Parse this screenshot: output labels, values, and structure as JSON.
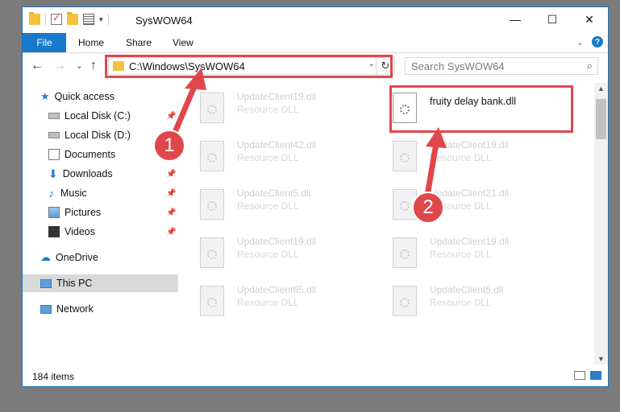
{
  "window": {
    "title": "SysWOW64"
  },
  "ribbon": {
    "tabs": [
      "File",
      "Home",
      "Share",
      "View"
    ]
  },
  "address": {
    "path": "C:\\Windows\\SysWOW64"
  },
  "search": {
    "placeholder": "Search SysWOW64"
  },
  "nav": {
    "quick_access": "Quick access",
    "items": [
      "Local Disk (C:)",
      "Local Disk (D:)",
      "Documents",
      "Downloads",
      "Music",
      "Pictures",
      "Videos"
    ],
    "onedrive": "OneDrive",
    "this_pc": "This PC",
    "network": "Network"
  },
  "files": {
    "left": [
      {
        "name": "UpdateClient19.dll",
        "type": "Resource DLL"
      },
      {
        "name": "UpdateClient42.dll",
        "type": "Resource DLL"
      },
      {
        "name": "UpdateClient5.dll",
        "type": "Resource DLL"
      },
      {
        "name": "UpdateClient19.dll",
        "type": "Resource DLL"
      },
      {
        "name": "UpdateClient65.dll",
        "type": "Resource DLL"
      }
    ],
    "right": [
      {
        "name": "fruity delay bank.dll",
        "type": ""
      },
      {
        "name": "UpdateClient19.dll",
        "type": "Resource DLL"
      },
      {
        "name": "UpdateClient21.dll",
        "type": "Resource DLL"
      },
      {
        "name": "UpdateClient19.dll",
        "type": "Resource DLL"
      },
      {
        "name": "UpdateClient5.dll",
        "type": "Resource DLL"
      }
    ]
  },
  "status": {
    "item_count": "184 items"
  },
  "callouts": [
    "1",
    "2"
  ],
  "colors": {
    "accent": "#1979ca",
    "highlight": "#e0474c"
  }
}
